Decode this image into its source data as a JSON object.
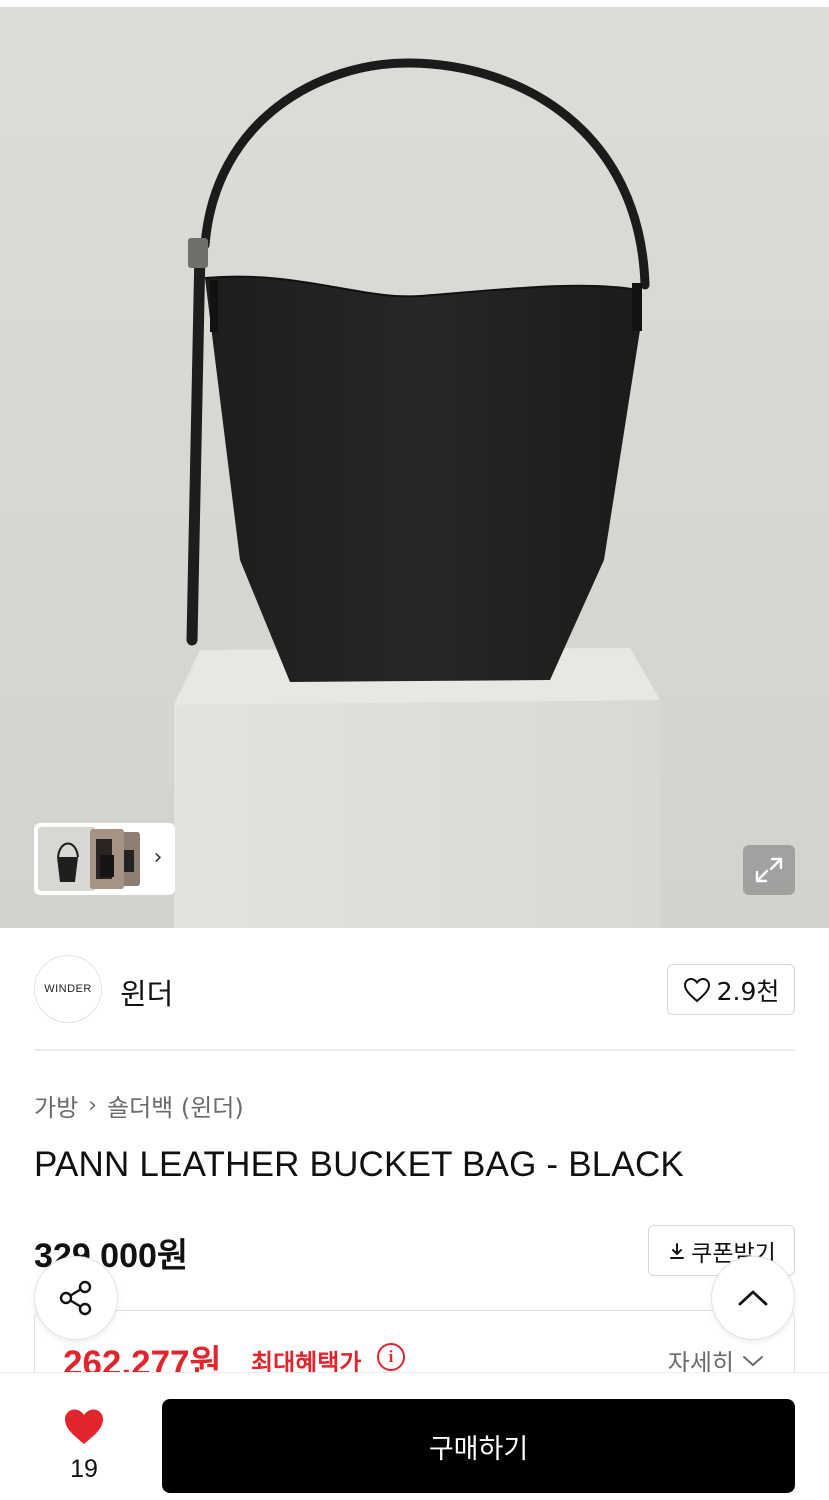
{
  "hero": {
    "image_label": "product-image-black-bucket-bag",
    "background_color": "#d9dad6",
    "thumbnails_next_icon": "chevron-right-icon",
    "expand_icon": "expand-icon"
  },
  "brand": {
    "logo_text": "WINDER",
    "name": "윈더",
    "like_count": "2.9천",
    "like_icon": "heart-outline-icon"
  },
  "breadcrumb": {
    "items": [
      "가방",
      "숄더백 (윈더)"
    ],
    "separator_icon": "chevron-right-icon"
  },
  "product": {
    "title": "PANN LEATHER BUCKET BAG - BLACK",
    "price": "329,000원",
    "coupon_label": "쿠폰받기",
    "coupon_icon": "download-icon"
  },
  "benefit": {
    "price": "262,277원",
    "label": "최대혜택가",
    "info_icon": "i",
    "detail_label": "자세히",
    "detail_icon": "chevron-down-icon",
    "accent_color": "#e0252d"
  },
  "floating": {
    "share_icon": "share-icon",
    "scroll_top_icon": "chevron-up-icon"
  },
  "bottom_bar": {
    "wish_count": "19",
    "wish_icon": "heart-filled-icon",
    "buy_label": "구매하기"
  }
}
